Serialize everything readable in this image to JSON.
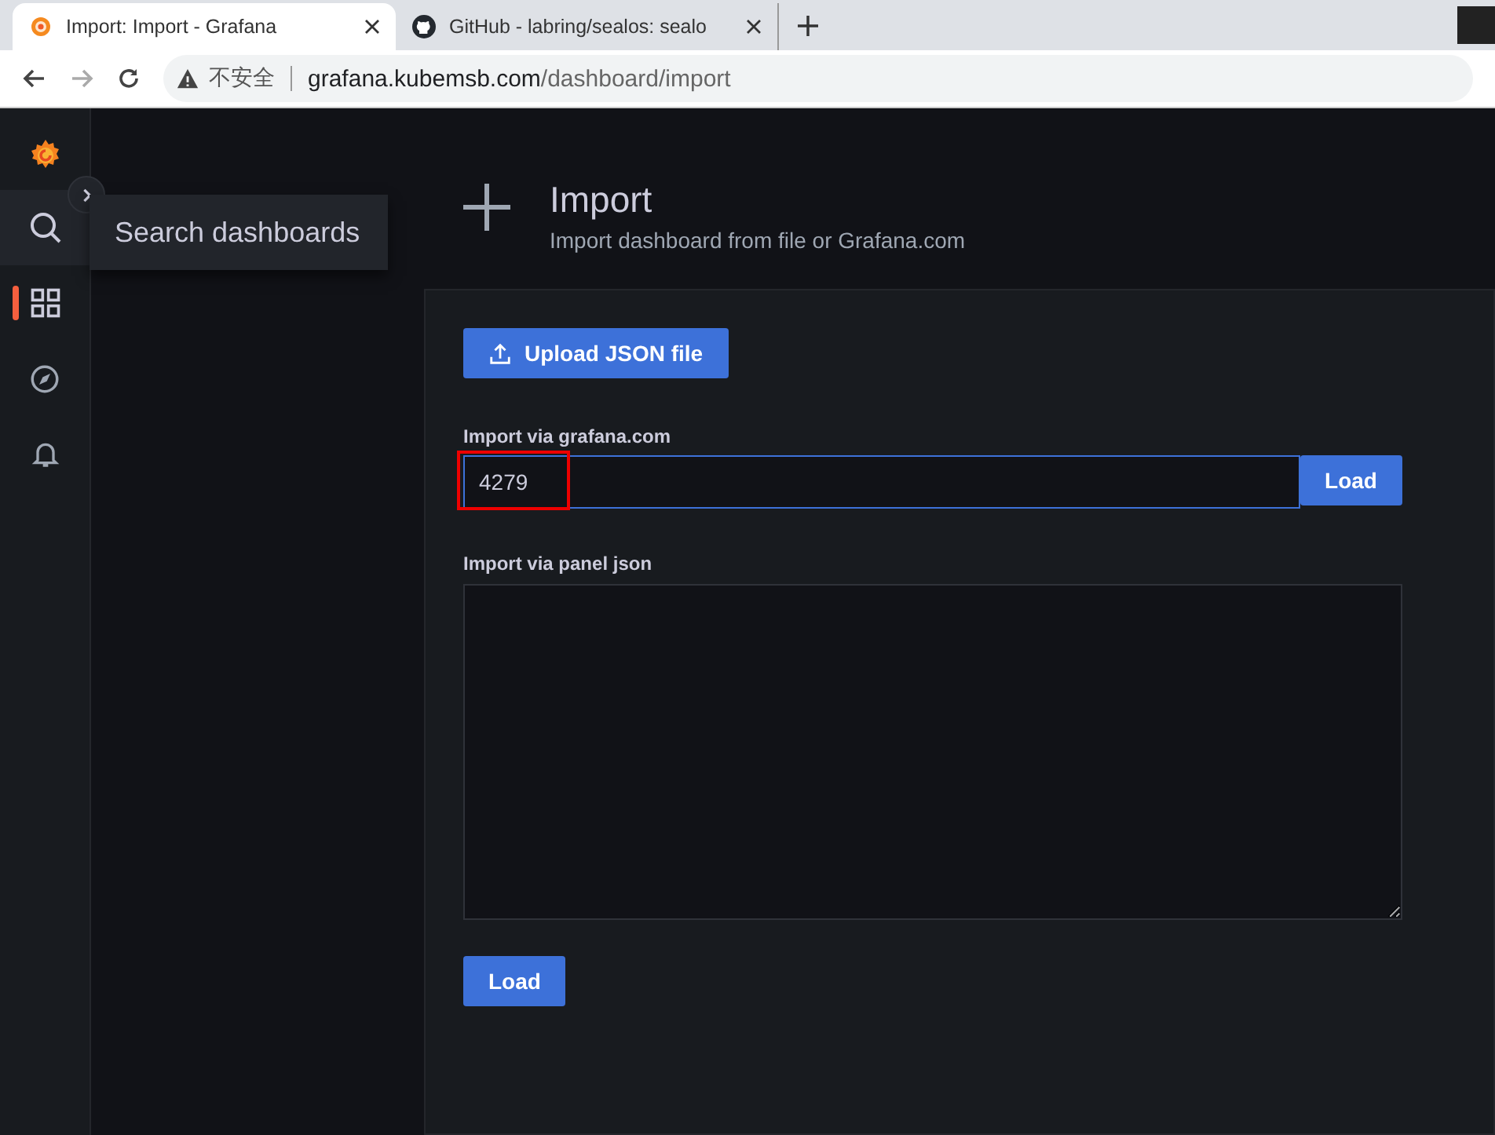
{
  "browser": {
    "tabs": [
      {
        "title": "Import: Import - Grafana",
        "selected": true,
        "kind": "grafana"
      },
      {
        "title": "GitHub - labring/sealos: sealo",
        "selected": false,
        "kind": "github"
      }
    ],
    "security": "不安全",
    "url": {
      "host": "grafana.kubemsb.com",
      "path": "/dashboard/import"
    }
  },
  "sidebar": {
    "items": [
      {
        "kind": "search",
        "selected": false,
        "hovered": true
      },
      {
        "kind": "dashboards",
        "selected": true,
        "hovered": false
      },
      {
        "kind": "explore",
        "selected": false,
        "hovered": false
      },
      {
        "kind": "alerting",
        "selected": false,
        "hovered": false
      }
    ],
    "tooltip": "Search dashboards"
  },
  "page": {
    "title": "Import",
    "subtitle": "Import dashboard from file or Grafana.com"
  },
  "form": {
    "upload_button": "Upload JSON file",
    "grafana_label": "Import via grafana.com",
    "grafana_value": "4279",
    "grafana_load": "Load",
    "json_label": "Import via panel json",
    "load_button": "Load"
  }
}
